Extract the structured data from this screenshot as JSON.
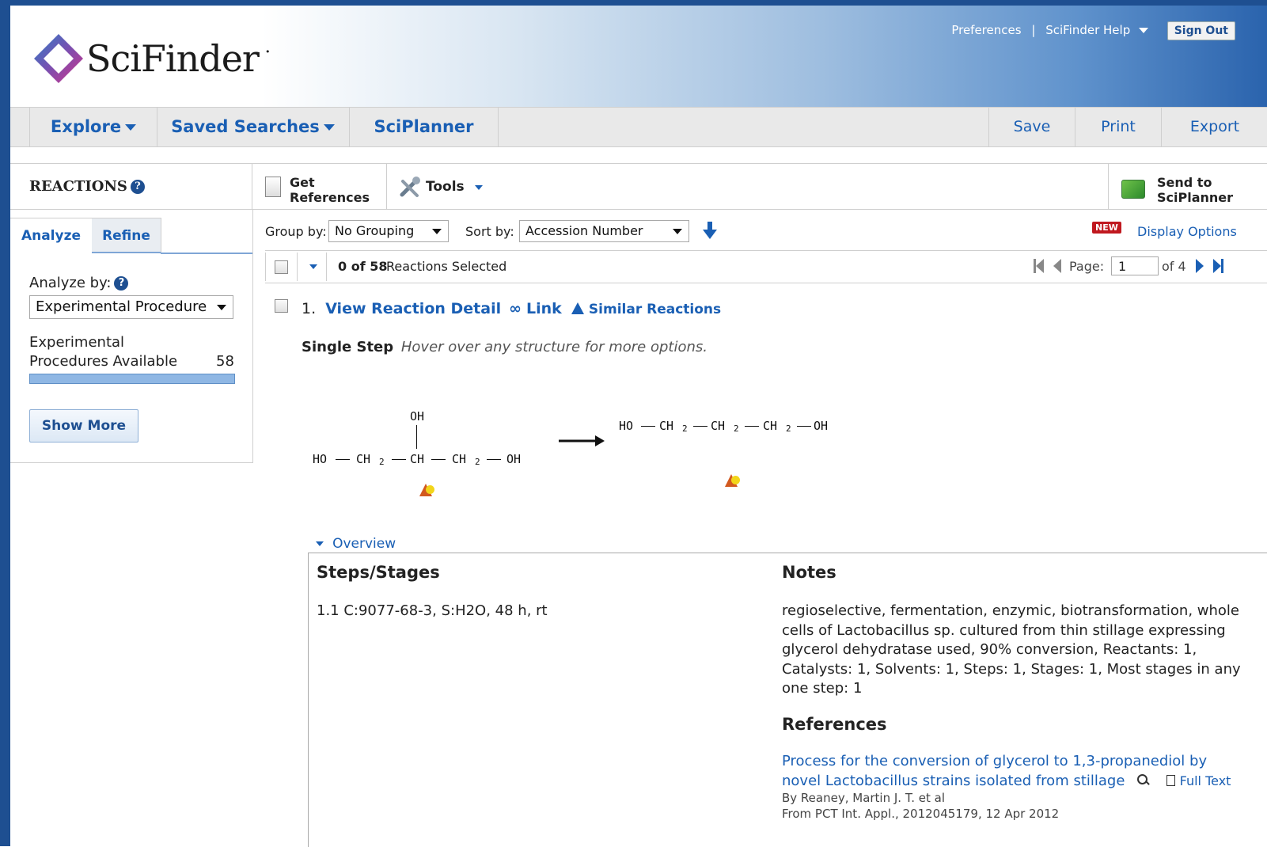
{
  "header": {
    "logo_text": "SciFinder",
    "links": [
      "Preferences",
      "SciFinder Help"
    ],
    "separator": "|",
    "sign_out": "Sign Out"
  },
  "nav": {
    "left": [
      "Explore",
      "Saved Searches",
      "SciPlanner"
    ],
    "right": [
      "Save",
      "Print",
      "Export"
    ]
  },
  "toolbar": {
    "title": "REACTIONS",
    "get_references": [
      "Get",
      "References"
    ],
    "tools": "Tools",
    "send_to": [
      "Send to",
      "SciPlanner"
    ]
  },
  "left_panel": {
    "tabs": [
      "Analyze",
      "Refine"
    ],
    "analyze_by_label": "Analyze by:",
    "analyze_by_value": "Experimental Procedure",
    "category_label_line1": "Experimental",
    "category_label_line2": "Procedures Available",
    "category_count": "58",
    "category_fill": 1.0,
    "show_more": "Show More"
  },
  "controls": {
    "group_by_label": "Group by:",
    "group_by_value": "No Grouping",
    "sort_by_label": "Sort by:",
    "sort_by_value": "Accession Number",
    "new_badge": "NEW",
    "display_options": "Display Options"
  },
  "selection": {
    "selected_count": "0 of 58",
    "selected_suffix": "Reactions Selected",
    "page_label": "Page:",
    "page_value": "1",
    "page_total": "of 4"
  },
  "result": {
    "index": "1.",
    "view_detail": "View Reaction Detail",
    "link": "Link",
    "similar": "Similar Reactions",
    "step_type": "Single Step",
    "hover_hint": "Hover over any structure for more options.",
    "reactant": {
      "oh_top": "OH",
      "ho": "HO",
      "ch2_a": "CH",
      "sub_a": "2",
      "ch": "CH",
      "ch2_b": "CH",
      "sub_b": "2",
      "oh": "OH"
    },
    "product": {
      "ho": "HO",
      "ch2_a": "CH",
      "sub_a": "2",
      "ch2_b": "CH",
      "sub_b": "2",
      "ch2_c": "CH",
      "sub_c": "2",
      "oh": "OH"
    },
    "overview_label": "Overview",
    "steps_header": "Steps/Stages",
    "step_text": "1.1  C:9077-68-3, S:H2O, 48 h, rt",
    "notes_header": "Notes",
    "notes_text": "regioselective, fermentation, enzymic, biotransformation, whole cells of Lactobacillus sp. cultured from thin stillage expressing glycerol dehydratase used, 90% conversion, Reactants: 1, Catalysts: 1, Solvents: 1, Steps: 1, Stages: 1, Most stages in any one step: 1",
    "references_header": "References",
    "ref_title": "Process for the conversion of glycerol to 1,3-propanediol by novel Lactobacillus strains isolated from stillage",
    "full_text": "Full Text",
    "ref_authors": "By Reaney, Martin J. T. et al",
    "ref_source": "From PCT Int. Appl., 2012045179, 12 Apr 2012"
  }
}
